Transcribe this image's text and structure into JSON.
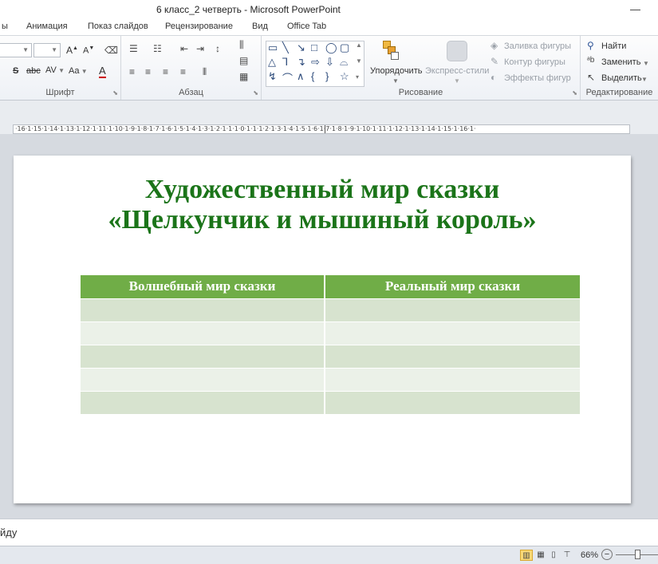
{
  "window": {
    "title": "6 класс_2 четверть  -  Microsoft PowerPoint",
    "minimize": "—"
  },
  "tabs": [
    {
      "label": "ы"
    },
    {
      "label": "Анимация"
    },
    {
      "label": "Показ слайдов"
    },
    {
      "label": "Рецензирование"
    },
    {
      "label": "Вид"
    },
    {
      "label": "Office Tab"
    }
  ],
  "ribbon": {
    "font_group": {
      "label": "Шрифт",
      "grow_font": "A",
      "shrink_font": "A",
      "shadow": "S",
      "strike": "abc",
      "spacing": "AV",
      "change_case": "Aa",
      "font_color": "A"
    },
    "paragraph_group": {
      "label": "Абзац"
    },
    "drawing_group": {
      "label": "Рисование",
      "arrange_label": "Упорядочить",
      "quick_styles_label": "Экспресс-стили",
      "shape_fill": "Заливка фигуры",
      "shape_outline": "Контур фигуры",
      "shape_effects": "Эффекты фигур"
    },
    "editing_group": {
      "label": "Редактирование",
      "find": "Найти",
      "replace": "Заменить",
      "select": "Выделить"
    }
  },
  "ruler": {
    "text": "·16·1·15·1·14·1·13·1·12·1·11·1·10·1·9·1·8·1·7·1·6·1·5·1·4·1·3·1·2·1·1·1·0·1·1·1·2·1·3·1·4·1·5·1·6·1·7·1·8·1·9·1·10·1·11·1·12·1·13·1·14·1·15·1·16·1·"
  },
  "slide": {
    "title_line1": "Художественный мир сказки",
    "title_line2": "«Щелкунчик и мышиный король»",
    "table": {
      "headers": [
        "Волшебный мир  сказки",
        "Реальный мир  сказки"
      ],
      "row_count": 5
    }
  },
  "notes": {
    "placeholder": "йду"
  },
  "status": {
    "zoom": "66%",
    "zoom_minus": "−"
  }
}
